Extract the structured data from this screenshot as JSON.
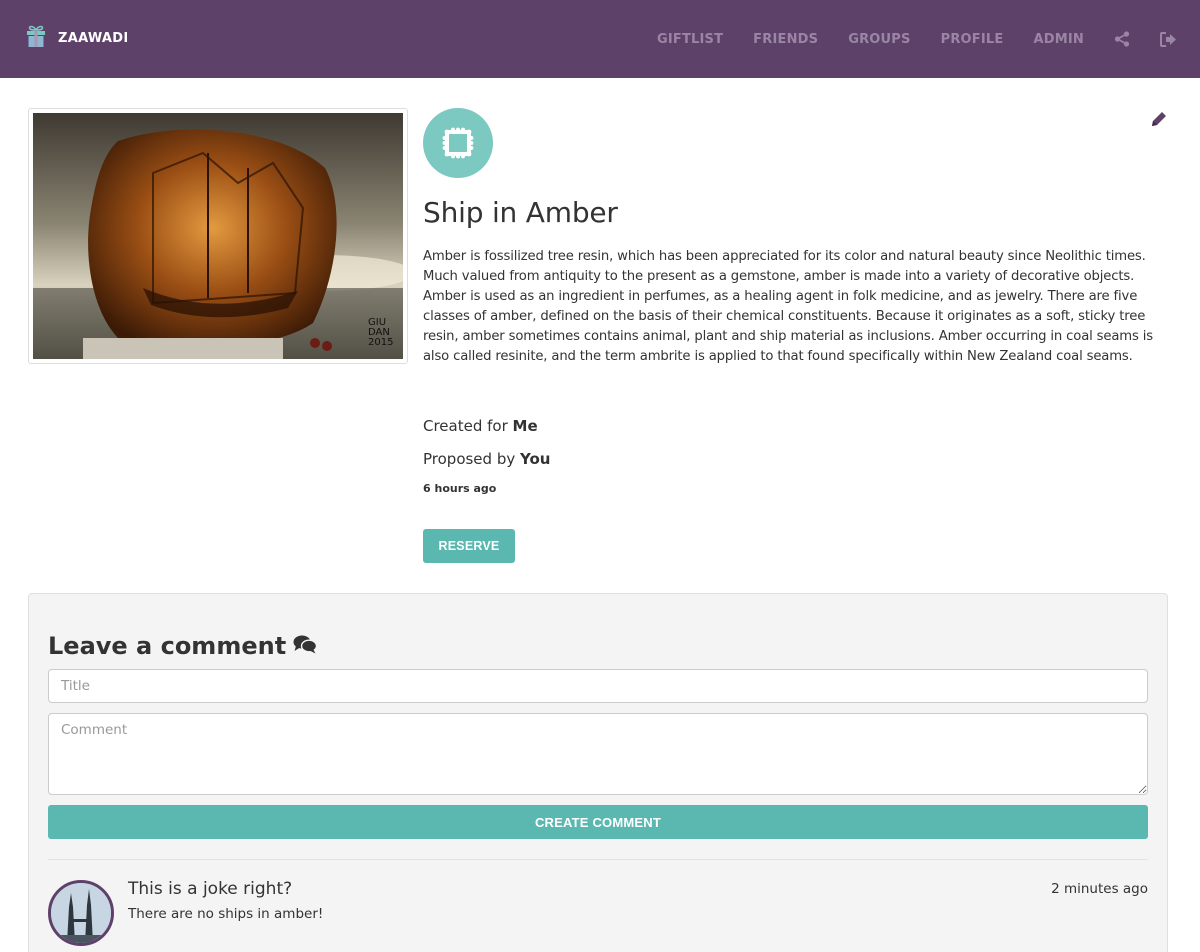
{
  "brand": {
    "name": "ZAAWADI",
    "icon": "gift-icon"
  },
  "nav": {
    "links": [
      "GIFTLIST",
      "FRIENDS",
      "GROUPS",
      "PROFILE",
      "ADMIN"
    ],
    "share_icon": "share-icon",
    "logout_icon": "sign-out-icon"
  },
  "item": {
    "image_signature": "GIU DAN 2015",
    "badge_icon": "stamp-icon",
    "edit_icon": "pencil-icon",
    "title": "Ship in Amber",
    "description": "Amber is fossilized tree resin, which has been appreciated for its color and natural beauty since Neolithic times. Much valued from antiquity to the present as a gemstone, amber is made into a variety of decorative objects. Amber is used as an ingredient in perfumes, as a healing agent in folk medicine, and as jewelry. There are five classes of amber, defined on the basis of their chemical constituents. Because it originates as a soft, sticky tree resin, amber sometimes contains animal, plant and ship material as inclusions. Amber occurring in coal seams is also called resinite, and the term ambrite is applied to that found specifically within New Zealand coal seams.",
    "created_label": "Created for",
    "created_for": "Me",
    "proposed_label": "Proposed by",
    "proposed_by": "You",
    "time_ago": "6 hours ago",
    "reserve_label": "RESERVE"
  },
  "comment_form": {
    "heading": "Leave a comment",
    "heading_icon": "comments-icon",
    "title_placeholder": "Title",
    "title_value": "",
    "comment_placeholder": "Comment",
    "comment_value": "",
    "submit_label": "CREATE COMMENT"
  },
  "comments": [
    {
      "title": "This is a joke right?",
      "body": "There are no ships in amber!",
      "time": "2 minutes ago"
    }
  ],
  "colors": {
    "navbar": "#5e4169",
    "nav_link": "#9a86a4",
    "accent": "#5ab8b0",
    "badge": "#7cc9c2",
    "panel": "#f4f4f4"
  }
}
